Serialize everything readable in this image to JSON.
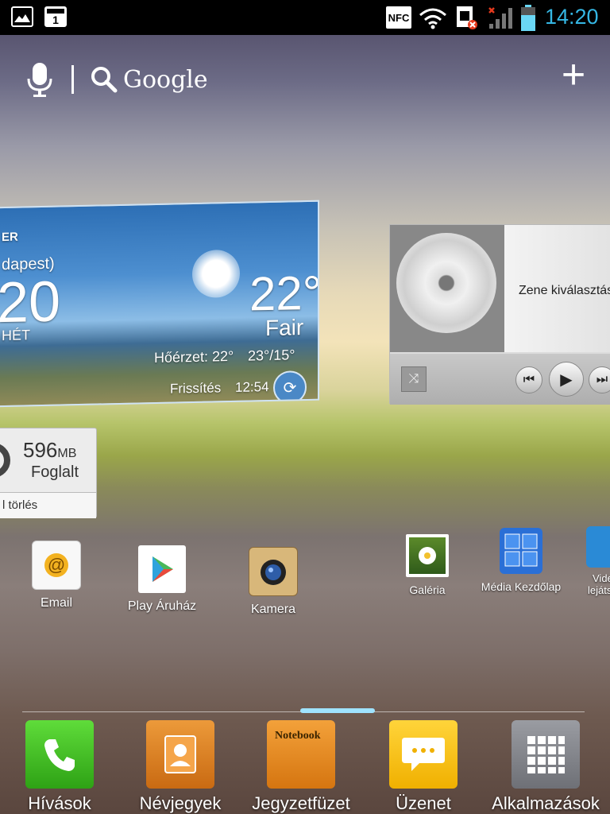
{
  "status_bar": {
    "left_icons": [
      "gallery-notification-icon",
      "calendar-notification-icon"
    ],
    "nfc_label": "NFC",
    "right_icons": [
      "wifi-icon",
      "sim-error-icon",
      "no-signal-icon",
      "battery-icon"
    ],
    "time": "14:20"
  },
  "search": {
    "google_label": "Google",
    "icons": [
      "microphone-icon",
      "search-icon",
      "add-icon"
    ]
  },
  "weather": {
    "city_partial": "dapest)",
    "header_partial": "ER",
    "left_temp_partial": "20",
    "left_day_partial": "HÉT",
    "temp": "22°",
    "condition": "Fair",
    "feels_like": "Hőérzet: 22°",
    "high_low": "23°/15°",
    "refresh_label": "Frissítés",
    "refresh_time": "12:54"
  },
  "music": {
    "prompt_partial": "Zene kiválasztás"
  },
  "memory": {
    "value": "596",
    "unit": "MB",
    "used_label": "Foglalt",
    "clear_partial": "l törlés"
  },
  "apps": [
    {
      "label": "Email",
      "icon": "email-icon"
    },
    {
      "label": "Play Áruház",
      "icon": "play-store-icon"
    },
    {
      "label": "Kamera",
      "icon": "camera-icon"
    },
    {
      "label": "Galéria",
      "icon": "gallery-icon"
    },
    {
      "label": "Média Kezdőlap",
      "icon": "media-home-icon"
    },
    {
      "label": "Vide",
      "label2": "lejáts",
      "icon": "video-player-icon"
    }
  ],
  "dock": [
    {
      "label": "Hívások",
      "icon": "phone-icon",
      "color": "#3fbf1f"
    },
    {
      "label": "Névjegyek",
      "icon": "contacts-icon",
      "color": "#d77a1e"
    },
    {
      "label": "Jegyzetfüzet",
      "icon": "notebook-icon",
      "color": "#e38a1a",
      "notebook_text": "Notebook"
    },
    {
      "label": "Üzenet",
      "icon": "message-icon",
      "color": "#f4c210"
    },
    {
      "label": "Alkalmazások",
      "icon": "apps-grid-icon",
      "color": "#8d8f95"
    }
  ],
  "colors": {
    "clock": "#35b7e4",
    "dock_indicator": "#9fe3ff"
  }
}
